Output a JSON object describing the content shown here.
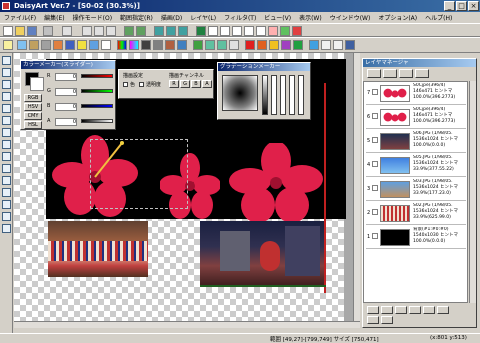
{
  "window": {
    "title": "DaisyArt Ver.7 - [S0-02 (30.3%)]",
    "minimize": "_",
    "maximize": "□",
    "close": "×"
  },
  "menu": [
    "ファイル(F)",
    "編集(E)",
    "操作モード(O)",
    "範囲指定(R)",
    "描画(D)",
    "レイヤ(L)",
    "フィルタ(T)",
    "ビュー(V)",
    "表示(W)",
    "ウインドウ(W)",
    "オプション(A)",
    "ヘルプ(H)"
  ],
  "color_panel": {
    "title": "カラーメーカー(スライダー)",
    "modes": [
      "RGB",
      "HSV",
      "CMY",
      "HSL"
    ],
    "channels": [
      "R",
      "G",
      "B",
      "A"
    ],
    "values": [
      "0",
      "0",
      "0",
      "0"
    ]
  },
  "draw_panel": {
    "title": "描画設定",
    "opt1": "色",
    "opt2": "透明度",
    "channel_title": "描画チャンネル",
    "channels": [
      "R",
      "G",
      "B",
      "A"
    ]
  },
  "gradient_panel": {
    "title": "グラデーションメーカー"
  },
  "layer_panel": {
    "title": "レイヤマネージャ",
    "layers": [
      {
        "num": "7",
        "info": [
          "S0Cjpe(396/4)",
          "146x471 ヒントマ",
          "100.0%(396.2773)"
        ],
        "thumb": "flowers"
      },
      {
        "num": "6",
        "info": [
          "S0Cjpe(396/4)",
          "146x471 ヒントマ",
          "100.0%(396.2773)"
        ],
        "thumb": "flowers"
      },
      {
        "num": "5",
        "info": [
          "S06.JPG (1/98/05.",
          "1536x1024 ヒントマ",
          "100.0%(0.0.0)"
        ],
        "thumb": "city"
      },
      {
        "num": "4",
        "info": [
          "S05.JPG (1/98/05.",
          "1536x1024 ヒントマ",
          "33.9%(377.55.22)"
        ],
        "thumb": "blue"
      },
      {
        "num": "3",
        "info": [
          "S03.JPG (1/98/05.",
          "1536x1024 ヒントマ",
          "33.9%(177.23.0)"
        ],
        "thumb": "crowd"
      },
      {
        "num": "2",
        "info": [
          "S02.JPG (1/98/05.",
          "1536x1024 ヒントマ",
          "33.9%(625.99.0)"
        ],
        "thumb": "parade"
      },
      {
        "num": "1",
        "info": [
          "背景(#1:#0:#0)",
          "1540x1030 ヒントマ",
          "100.0%(0.0.0)"
        ],
        "thumb": "black"
      }
    ]
  },
  "status": {
    "range": "範囲 [49,27]-[799,749] サイズ [750,471]",
    "coords": "(x:801 y:513)"
  },
  "colors": {
    "titlebar": "#0a246a",
    "flower": "#e0204a",
    "canvas_bg": "#000000"
  }
}
